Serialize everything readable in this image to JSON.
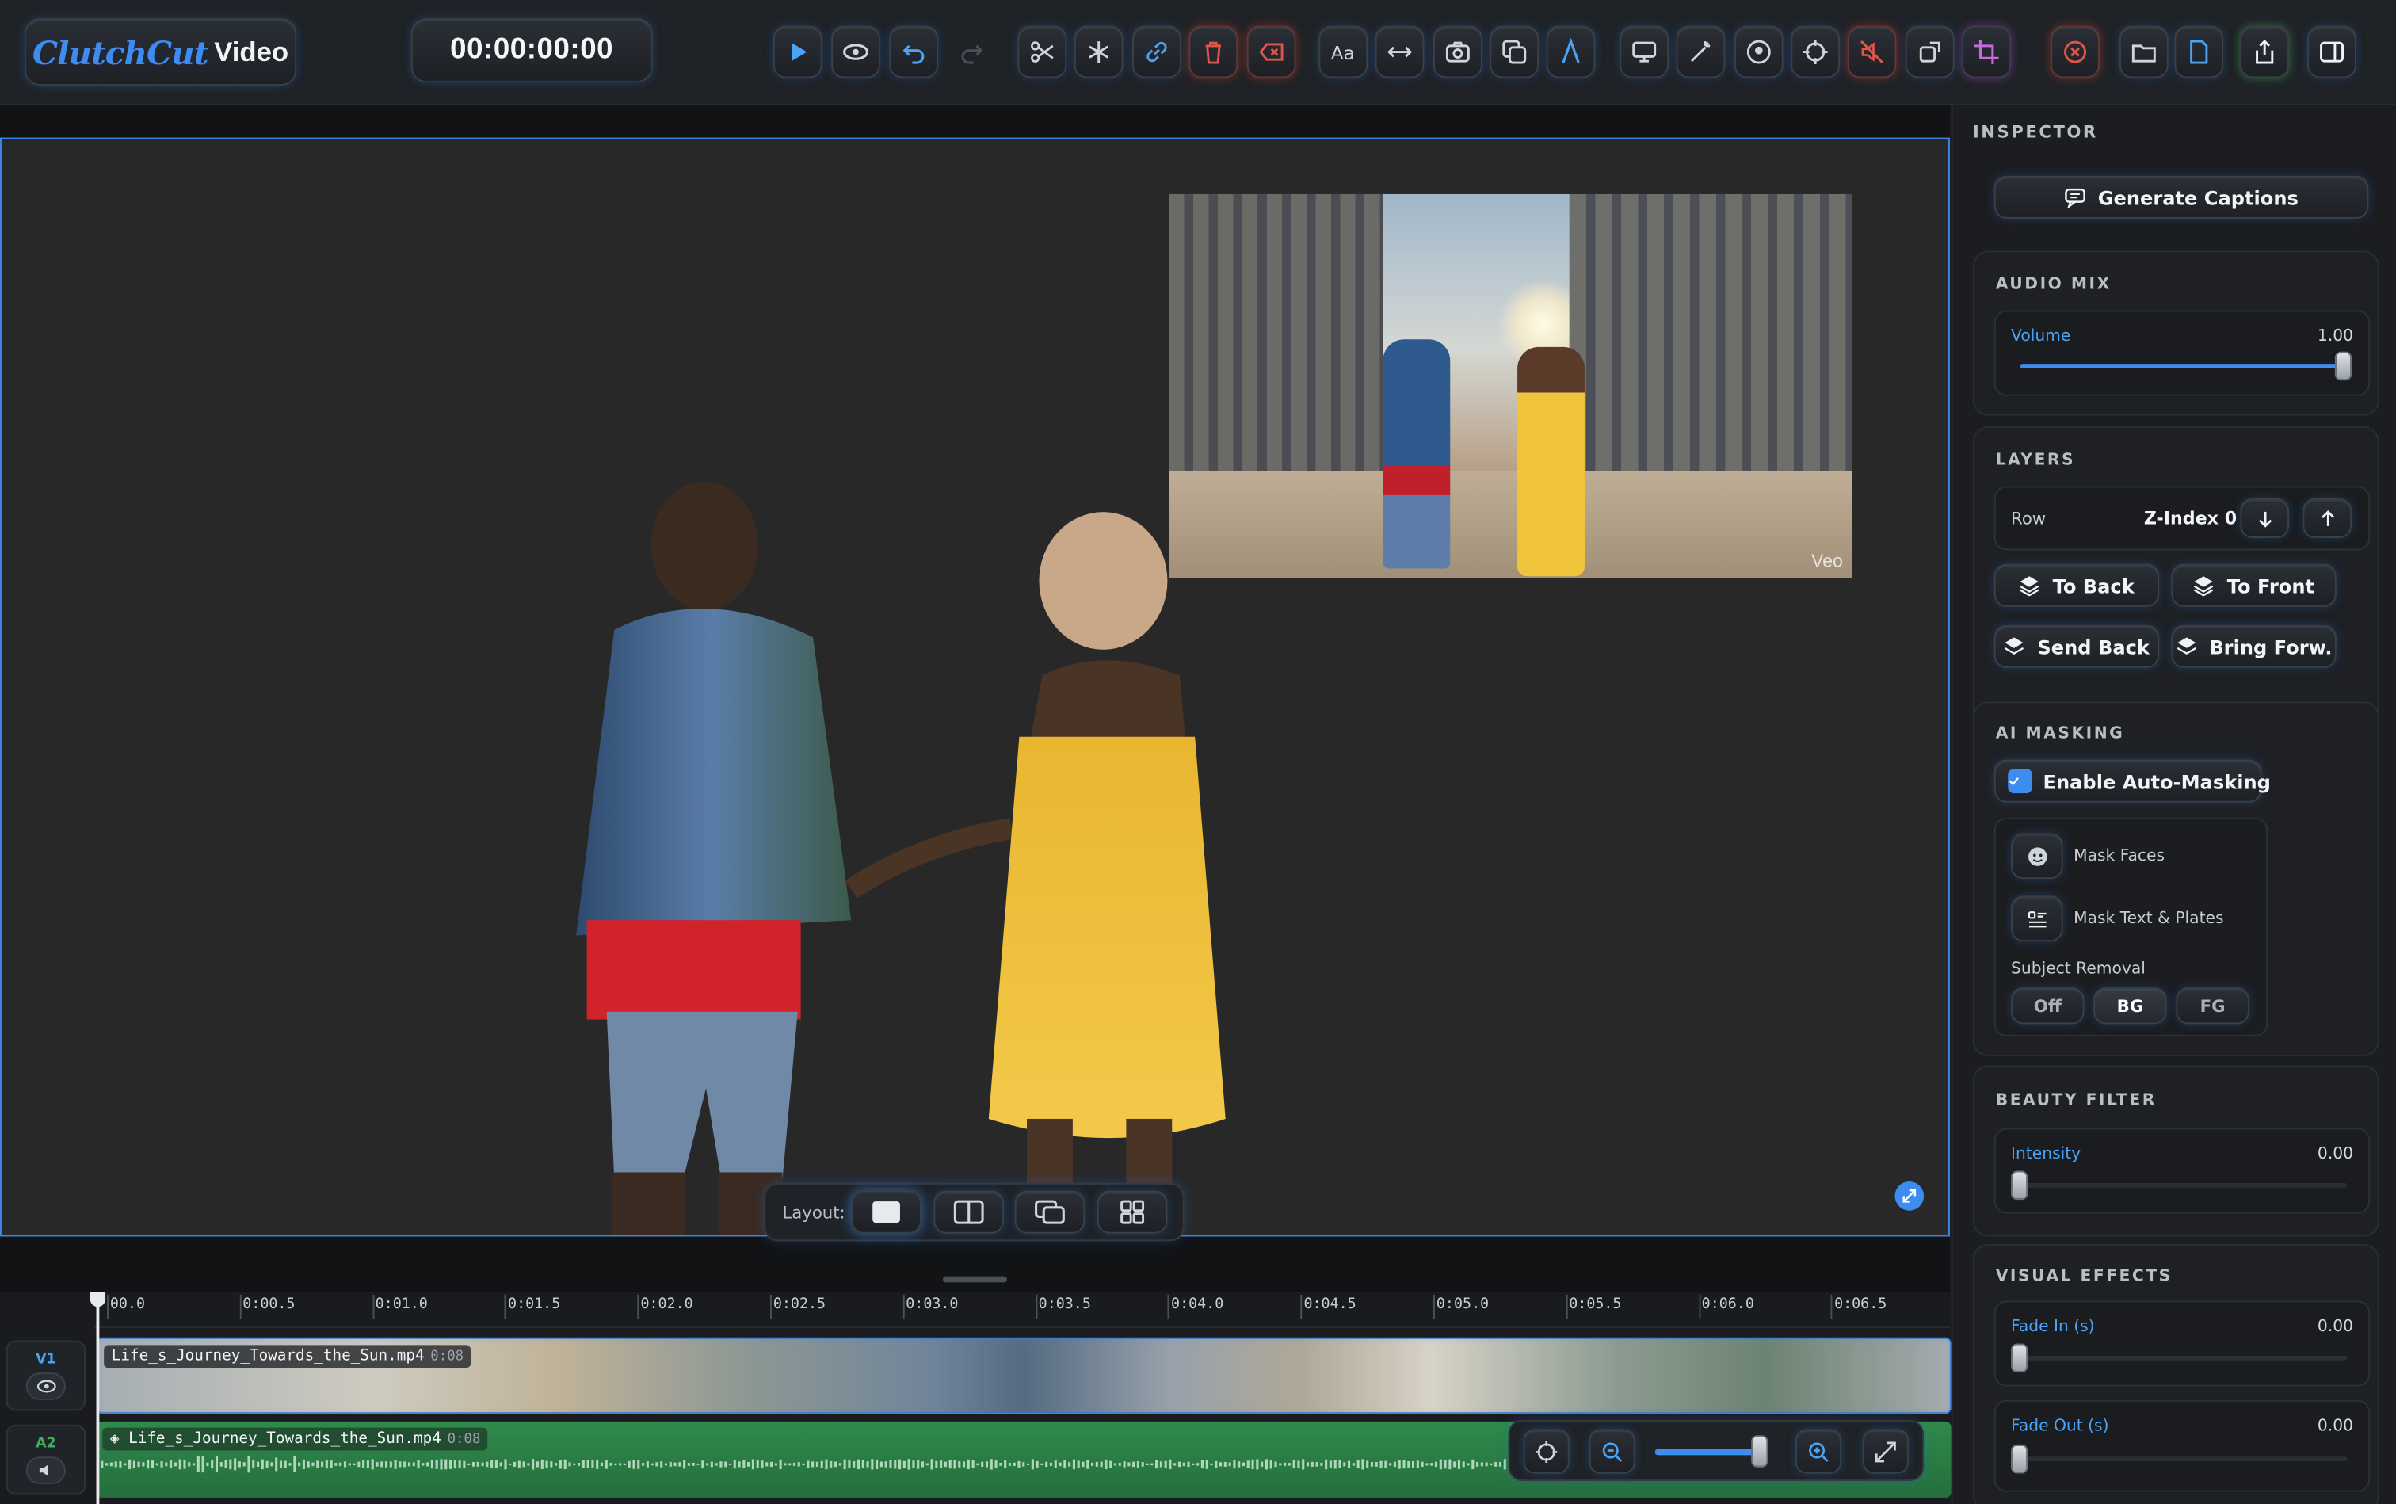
{
  "app": {
    "logo_script": "ClutchCut",
    "logo_word": "Video"
  },
  "toolbar": {
    "timecode": "00:00:00:00",
    "icons": [
      "play-icon",
      "eye-icon",
      "undo-icon",
      "redo-icon",
      "scissors-icon",
      "snowflake-icon",
      "link-icon",
      "trash-icon",
      "delete-clip-icon",
      "text-icon",
      "swap-icon",
      "camera-icon",
      "duplicate-icon",
      "pen-icon",
      "monitor-icon",
      "magic-icon",
      "face-icon",
      "target-icon",
      "mute-icon",
      "rotate-icon",
      "crop-icon",
      "stop-icon",
      "folder-icon",
      "document-icon",
      "share-icon",
      "panel-icon"
    ]
  },
  "preview": {
    "watermark": "Veo",
    "layout_label": "Layout:"
  },
  "timeline": {
    "ticks": [
      "00.0",
      "0:00.5",
      "0:01.0",
      "0:01.5",
      "0:02.0",
      "0:02.5",
      "0:03.0",
      "0:03.5",
      "0:04.0",
      "0:04.5",
      "0:05.0",
      "0:05.5",
      "0:06.0",
      "0:06.5"
    ],
    "tracks": [
      {
        "id": "V1",
        "clip": "Life_s_Journey_Towards_the_Sun.mp4",
        "duration": "0:08"
      },
      {
        "id": "A2",
        "clip": "Life_s_Journey_Towards_the_Sun.mp4",
        "duration": "0:08"
      }
    ],
    "zoom_level": 0.95
  },
  "inspector": {
    "title": "INSPECTOR",
    "generate_captions": "Generate Captions",
    "audio_mix": {
      "title": "AUDIO MIX",
      "volume_label": "Volume",
      "volume_value": "1.00",
      "volume_level": 1.0
    },
    "layers": {
      "title": "LAYERS",
      "row_label": "Row",
      "zindex": "Z-Index 0",
      "to_back": "To Back",
      "to_front": "To Front",
      "send_back": "Send Back",
      "bring_forward": "Bring Forw."
    },
    "ai_masking": {
      "title": "AI MASKING",
      "enable_label": "Enable Auto-Masking",
      "enabled": true,
      "mask_faces": "Mask Faces",
      "mask_text": "Mask Text & Plates",
      "subject_removal": "Subject Removal",
      "options": [
        "Off",
        "BG",
        "FG"
      ],
      "selected": "BG"
    },
    "beauty_filter": {
      "title": "BEAUTY FILTER",
      "intensity_label": "Intensity",
      "intensity_value": "0.00",
      "intensity_level": 0.0
    },
    "visual_effects": {
      "title": "VISUAL EFFECTS",
      "fade_in_label": "Fade In (s)",
      "fade_in_value": "0.00",
      "fade_out_label": "Fade Out (s)",
      "fade_out_value": "0.00"
    }
  },
  "colors": {
    "accent": "#3d8cf0",
    "danger": "#c8403a",
    "success": "#3ab45a",
    "audio_track": "#2f8a4c"
  }
}
